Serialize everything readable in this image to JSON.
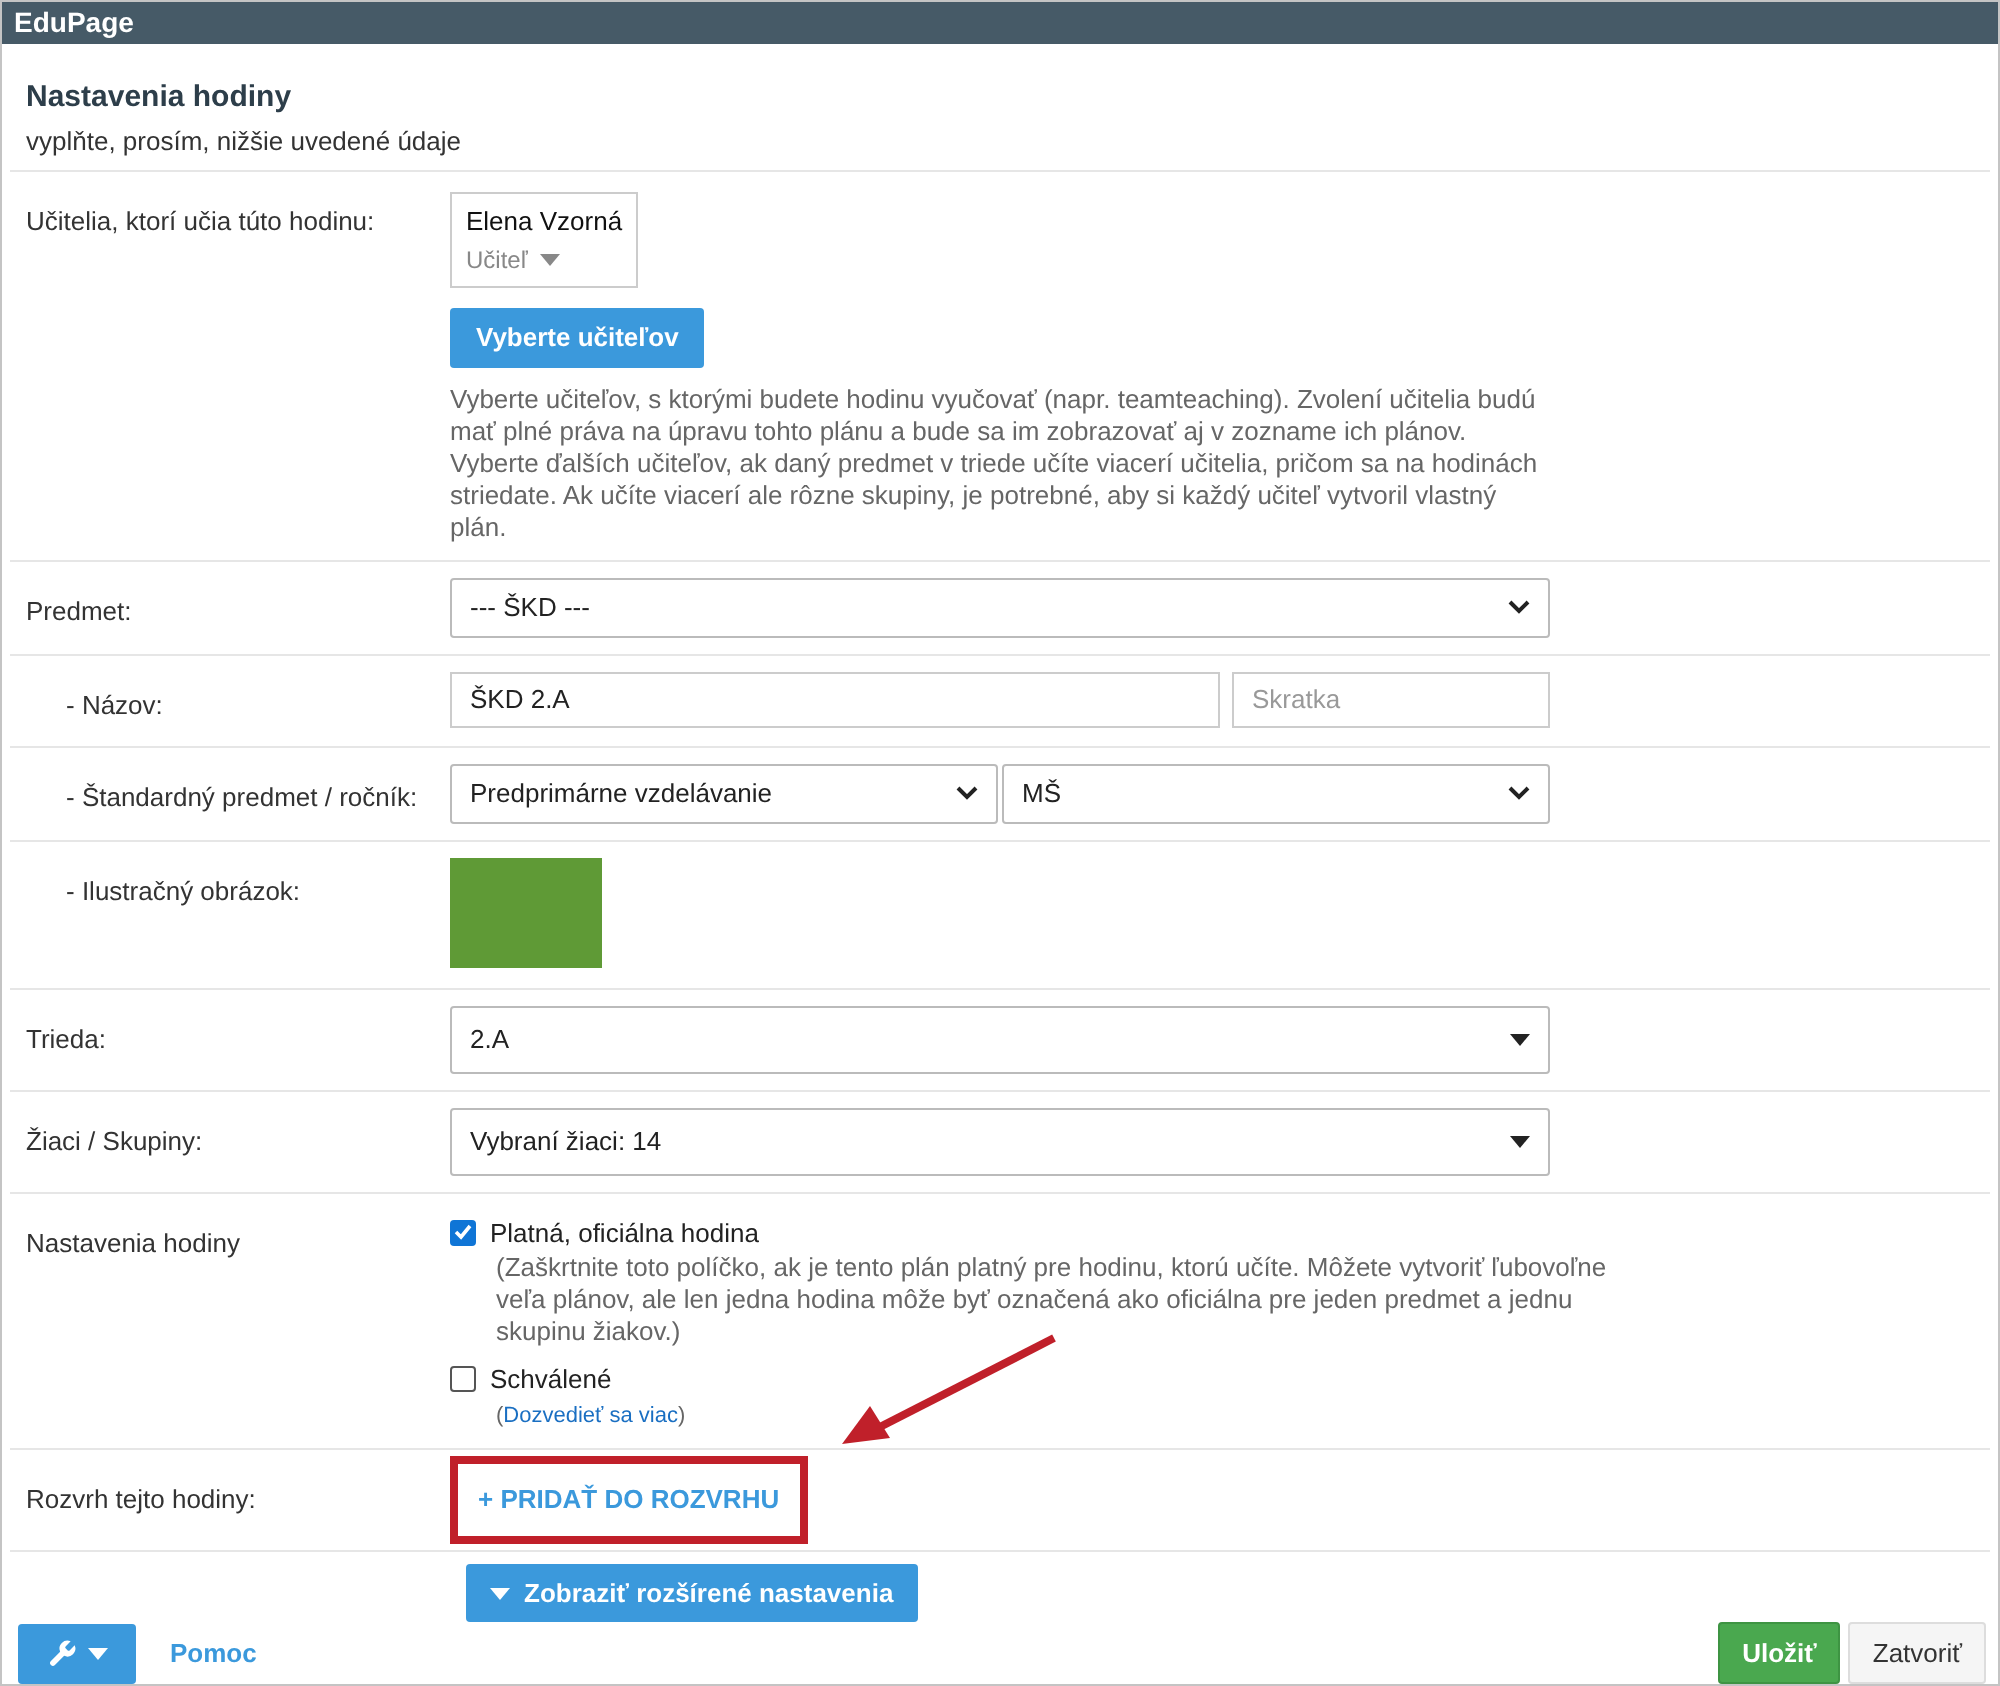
{
  "window": {
    "title": "EduPage"
  },
  "header": {
    "title": "Nastavenia hodiny",
    "subtitle": "vyplňte, prosím, nižšie uvedené údaje"
  },
  "teachers": {
    "label": "Učitelia, ktorí učia túto hodinu:",
    "teacher": {
      "name": "Elena Vzorná",
      "role": "Učiteľ"
    },
    "button": "Vyberte učiteľov",
    "help": "Vyberte učiteľov, s ktorými budete hodinu vyučovať (napr. teamteaching). Zvolení učitelia budú mať plné práva na úpravu tohto plánu a bude sa im zobrazovať aj v zozname ich plánov. Vyberte ďalších učiteľov, ak daný predmet v triede učíte viacerí učitelia, pričom sa na hodinách striedate. Ak učíte viacerí ale rôzne skupiny, je potrebné, aby si každý učiteľ vytvoril vlastný plán."
  },
  "subject": {
    "label": "Predmet:",
    "value": "--- ŠKD ---"
  },
  "name": {
    "label": "- Názov:",
    "value": "ŠKD 2.A",
    "short_placeholder": "Skratka"
  },
  "standard": {
    "label": "- Štandardný predmet / ročník:",
    "subject": "Predprimárne vzdelávanie",
    "grade": "MŠ"
  },
  "illustration": {
    "label": "- Ilustračný obrázok:"
  },
  "class": {
    "label": "Trieda:",
    "value": "2.A"
  },
  "students": {
    "label": "Žiaci / Skupiny:",
    "value": "Vybraní žiaci: 14"
  },
  "settings": {
    "label": "Nastavenia hodiny",
    "options": [
      {
        "label": "Platná, oficiálna hodina",
        "checked": true,
        "note": "(Zaškrtnite toto políčko, ak je tento plán platný pre hodinu, ktorú učíte. Môžete vytvoriť ľubovoľne veľa plánov, ale len jedna hodina môže byť označená ako oficiálna pre jeden predmet a jednu skupinu žiakov.)"
      },
      {
        "label": "Schválené",
        "checked": false,
        "link_open": "(",
        "link": "Dozvedieť sa viac",
        "link_close": ")"
      }
    ]
  },
  "schedule": {
    "label": "Rozvrh tejto hodiny:",
    "link": "+ PRIDAŤ DO ROZVRHU",
    "highlighted": true
  },
  "expand_button": "Zobraziť rozšírené nastavenia",
  "footer": {
    "help": "Pomoc",
    "save": "Uložiť",
    "close": "Zatvoriť"
  }
}
